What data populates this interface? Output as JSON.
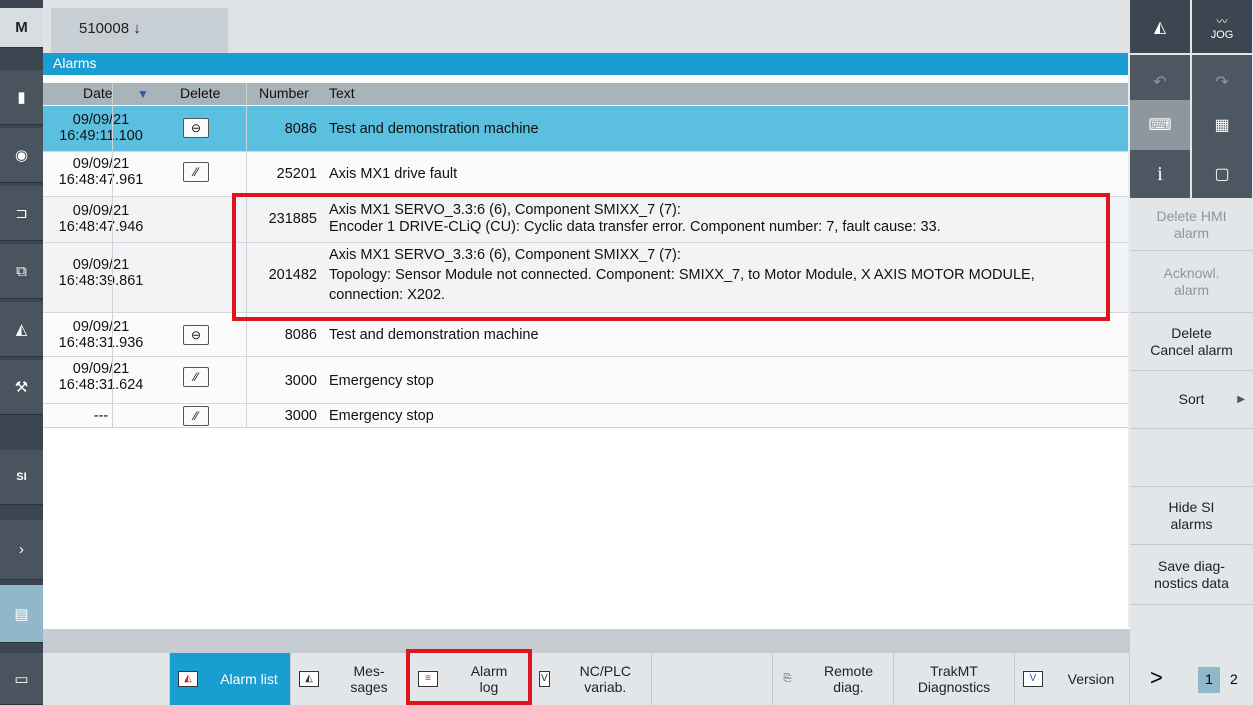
{
  "header": {
    "program_tab": "510008 ↓",
    "section_title": "Alarms"
  },
  "table": {
    "columns": [
      "Date",
      "Delete",
      "Number",
      "Text"
    ],
    "rows": [
      {
        "date": "09/09/21",
        "time": "16:49:11.100",
        "delete_icon": "⊖",
        "number": "8086",
        "text": [
          "Test and demonstration machine"
        ],
        "selected": true
      },
      {
        "date": "09/09/21",
        "time": "16:48:47.961",
        "delete_icon": "⁄⁄",
        "number": "25201",
        "text": [
          "Axis MX1 drive fault"
        ]
      },
      {
        "date": "09/09/21",
        "time": "16:48:47.946",
        "delete_icon": "",
        "number": "231885",
        "text": [
          "Axis MX1 SERVO_3.3:6 (6), Component SMIXX_7 (7):",
          "Encoder 1 DRIVE-CLiQ (CU): Cyclic data transfer error. Component number: 7, fault cause: 33."
        ]
      },
      {
        "date": "09/09/21",
        "time": "16:48:39.861",
        "delete_icon": "",
        "number": "201482",
        "text": [
          "Axis MX1 SERVO_3.3:6 (6), Component SMIXX_7 (7):",
          "Topology: Sensor Module not connected. Component: SMIXX_7, to Motor Module, X AXIS MOTOR MODULE,",
          "connection: X202."
        ]
      },
      {
        "date": "09/09/21",
        "time": "16:48:31.936",
        "delete_icon": "⊖",
        "number": "8086",
        "text": [
          "Test and demonstration machine"
        ]
      },
      {
        "date": "09/09/21",
        "time": "16:48:31.624",
        "delete_icon": "⁄⁄",
        "number": "3000",
        "text": [
          "Emergency stop"
        ]
      },
      {
        "date": "---",
        "time": "",
        "delete_icon": "⁄⁄",
        "number": "3000",
        "text": [
          "Emergency stop"
        ]
      }
    ]
  },
  "right_softkeys": {
    "delete_hmi": "Delete HMI alarm",
    "acknowledge": "Acknowl. alarm",
    "delete_cancel": "Delete Cancel alarm",
    "sort": "Sort",
    "hide_si": "Hide SI alarms",
    "save_diag": "Save diag- nostics data"
  },
  "bottom_softkeys": {
    "alarm_list": "Alarm list",
    "messages": "Mes- sages",
    "alarm_log": "Alarm log",
    "nc_plc": "NC/PLC variab.",
    "remote": "Remote diag.",
    "trakmt": "TrakMT Diagnostics",
    "version": "Version",
    "next": ">",
    "page1": "1",
    "page2": "2"
  },
  "top_right": {
    "jog": "JOG"
  },
  "colors": {
    "accent": "#199ed1",
    "selected_row": "#5bbfe0",
    "highlight": "#e0141e"
  }
}
